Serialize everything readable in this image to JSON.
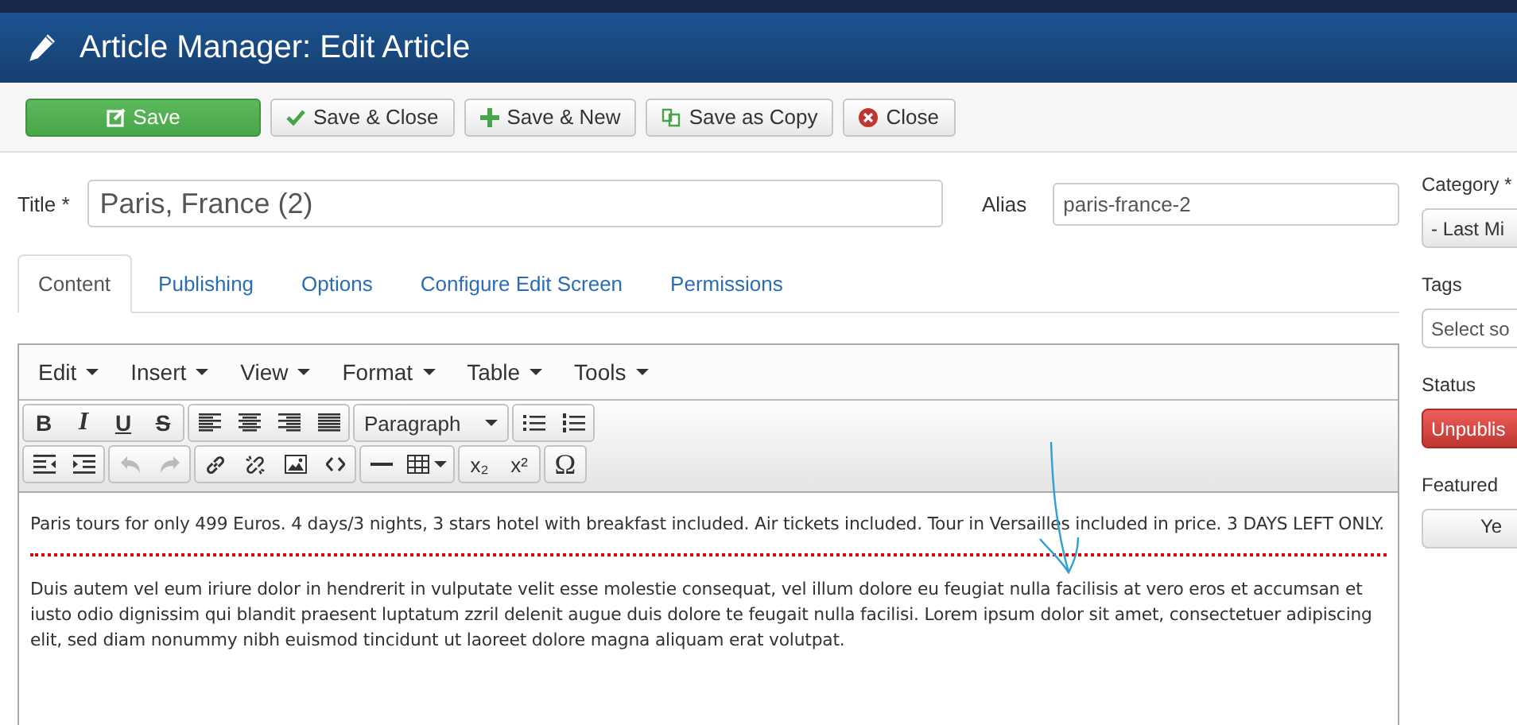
{
  "header": {
    "title": "Article Manager: Edit Article"
  },
  "toolbar": [
    {
      "kind": "save",
      "label": "Save"
    },
    {
      "kind": "check",
      "label": "Save & Close"
    },
    {
      "kind": "plus",
      "label": "Save & New"
    },
    {
      "kind": "copy",
      "label": "Save as Copy"
    },
    {
      "kind": "close",
      "label": "Close"
    }
  ],
  "title_field": {
    "label": "Title *",
    "value": "Paris, France (2)"
  },
  "alias_field": {
    "label": "Alias",
    "value": "paris-france-2"
  },
  "tabs": [
    {
      "label": "Content",
      "selected": true
    },
    {
      "label": "Publishing",
      "selected": false
    },
    {
      "label": "Options",
      "selected": false
    },
    {
      "label": "Configure Edit Screen",
      "selected": false
    },
    {
      "label": "Permissions",
      "selected": false
    }
  ],
  "editor": {
    "menus": [
      "Edit",
      "Insert",
      "View",
      "Format",
      "Table",
      "Tools"
    ],
    "format_buttons": [
      "B",
      "I",
      "U",
      "S"
    ],
    "block_format": "Paragraph",
    "history_buttons": [
      {
        "disabled": true
      },
      {
        "disabled": true
      }
    ],
    "script_buttons": [
      "x₂",
      "x²"
    ],
    "special_char": "Ω",
    "intro": "Paris tours for only 499 Euros. 4 days/3 nights, 3 stars hotel with breakfast included. Air tickets included. Tour in Versailles included in price. 3 DAYS LEFT ONLY.",
    "body": "Duis autem vel eum iriure dolor in hendrerit in vulputate velit esse molestie consequat, vel illum dolore eu feugiat nulla facilisis at vero eros et accumsan et iusto odio dignissim qui blandit praesent luptatum zzril delenit augue duis dolore te feugait nulla facilisi. Lorem ipsum dolor sit amet, consectetuer adipiscing elit, sed diam nonummy nibh euismod tincidunt ut laoreet dolore magna aliquam erat volutpat."
  },
  "sidebar": {
    "category": {
      "label": "Category *",
      "value": "- Last Mi"
    },
    "tags": {
      "label": "Tags",
      "placeholder": "Select so"
    },
    "status": {
      "label": "Status",
      "value": "Unpublis"
    },
    "featured": {
      "label": "Featured",
      "value": "Ye"
    }
  }
}
